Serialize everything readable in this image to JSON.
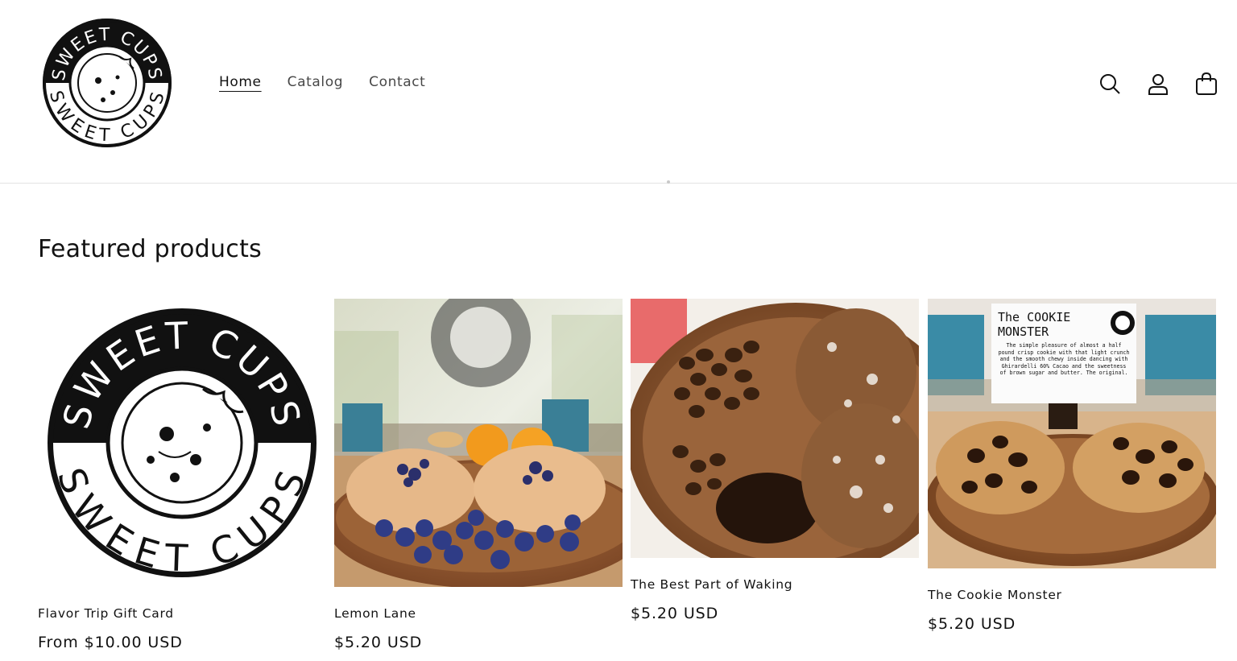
{
  "header": {
    "logo_text_top": "SWEET CUPS",
    "logo_text_bottom": "SWEET CUPS",
    "nav": [
      {
        "label": "Home",
        "active": true
      },
      {
        "label": "Catalog",
        "active": false
      },
      {
        "label": "Contact",
        "active": false
      }
    ],
    "icons": [
      "search-icon",
      "account-icon",
      "cart-icon"
    ]
  },
  "featured": {
    "title": "Featured products",
    "products": [
      {
        "name": "Flavor Trip Gift Card",
        "price": "From $10.00 USD",
        "image": "sweet-cups-logo"
      },
      {
        "name": "Lemon Lane",
        "price": "$5.20 USD",
        "image": "blueberry-lemon-cookies-photo"
      },
      {
        "name": "The Best Part of Waking",
        "price": "$5.20 USD",
        "image": "coffee-chocolate-cookies-photo"
      },
      {
        "name": "The Cookie Monster",
        "price": "$5.20 USD",
        "image": "chocolate-chip-cookies-photo"
      }
    ],
    "sign": {
      "title_line1": "The COOKIE",
      "title_line2": "MONSTER",
      "body": "The simple pleasure of almost a half pound crisp cookie with that light crunch and the smooth chewy inside dancing with Ghirardelli 60% Cacao and the sweetness of brown sugar and butter. The original."
    }
  },
  "colors": {
    "text": "#121212",
    "border": "#e3e3e3",
    "background": "#ffffff"
  }
}
